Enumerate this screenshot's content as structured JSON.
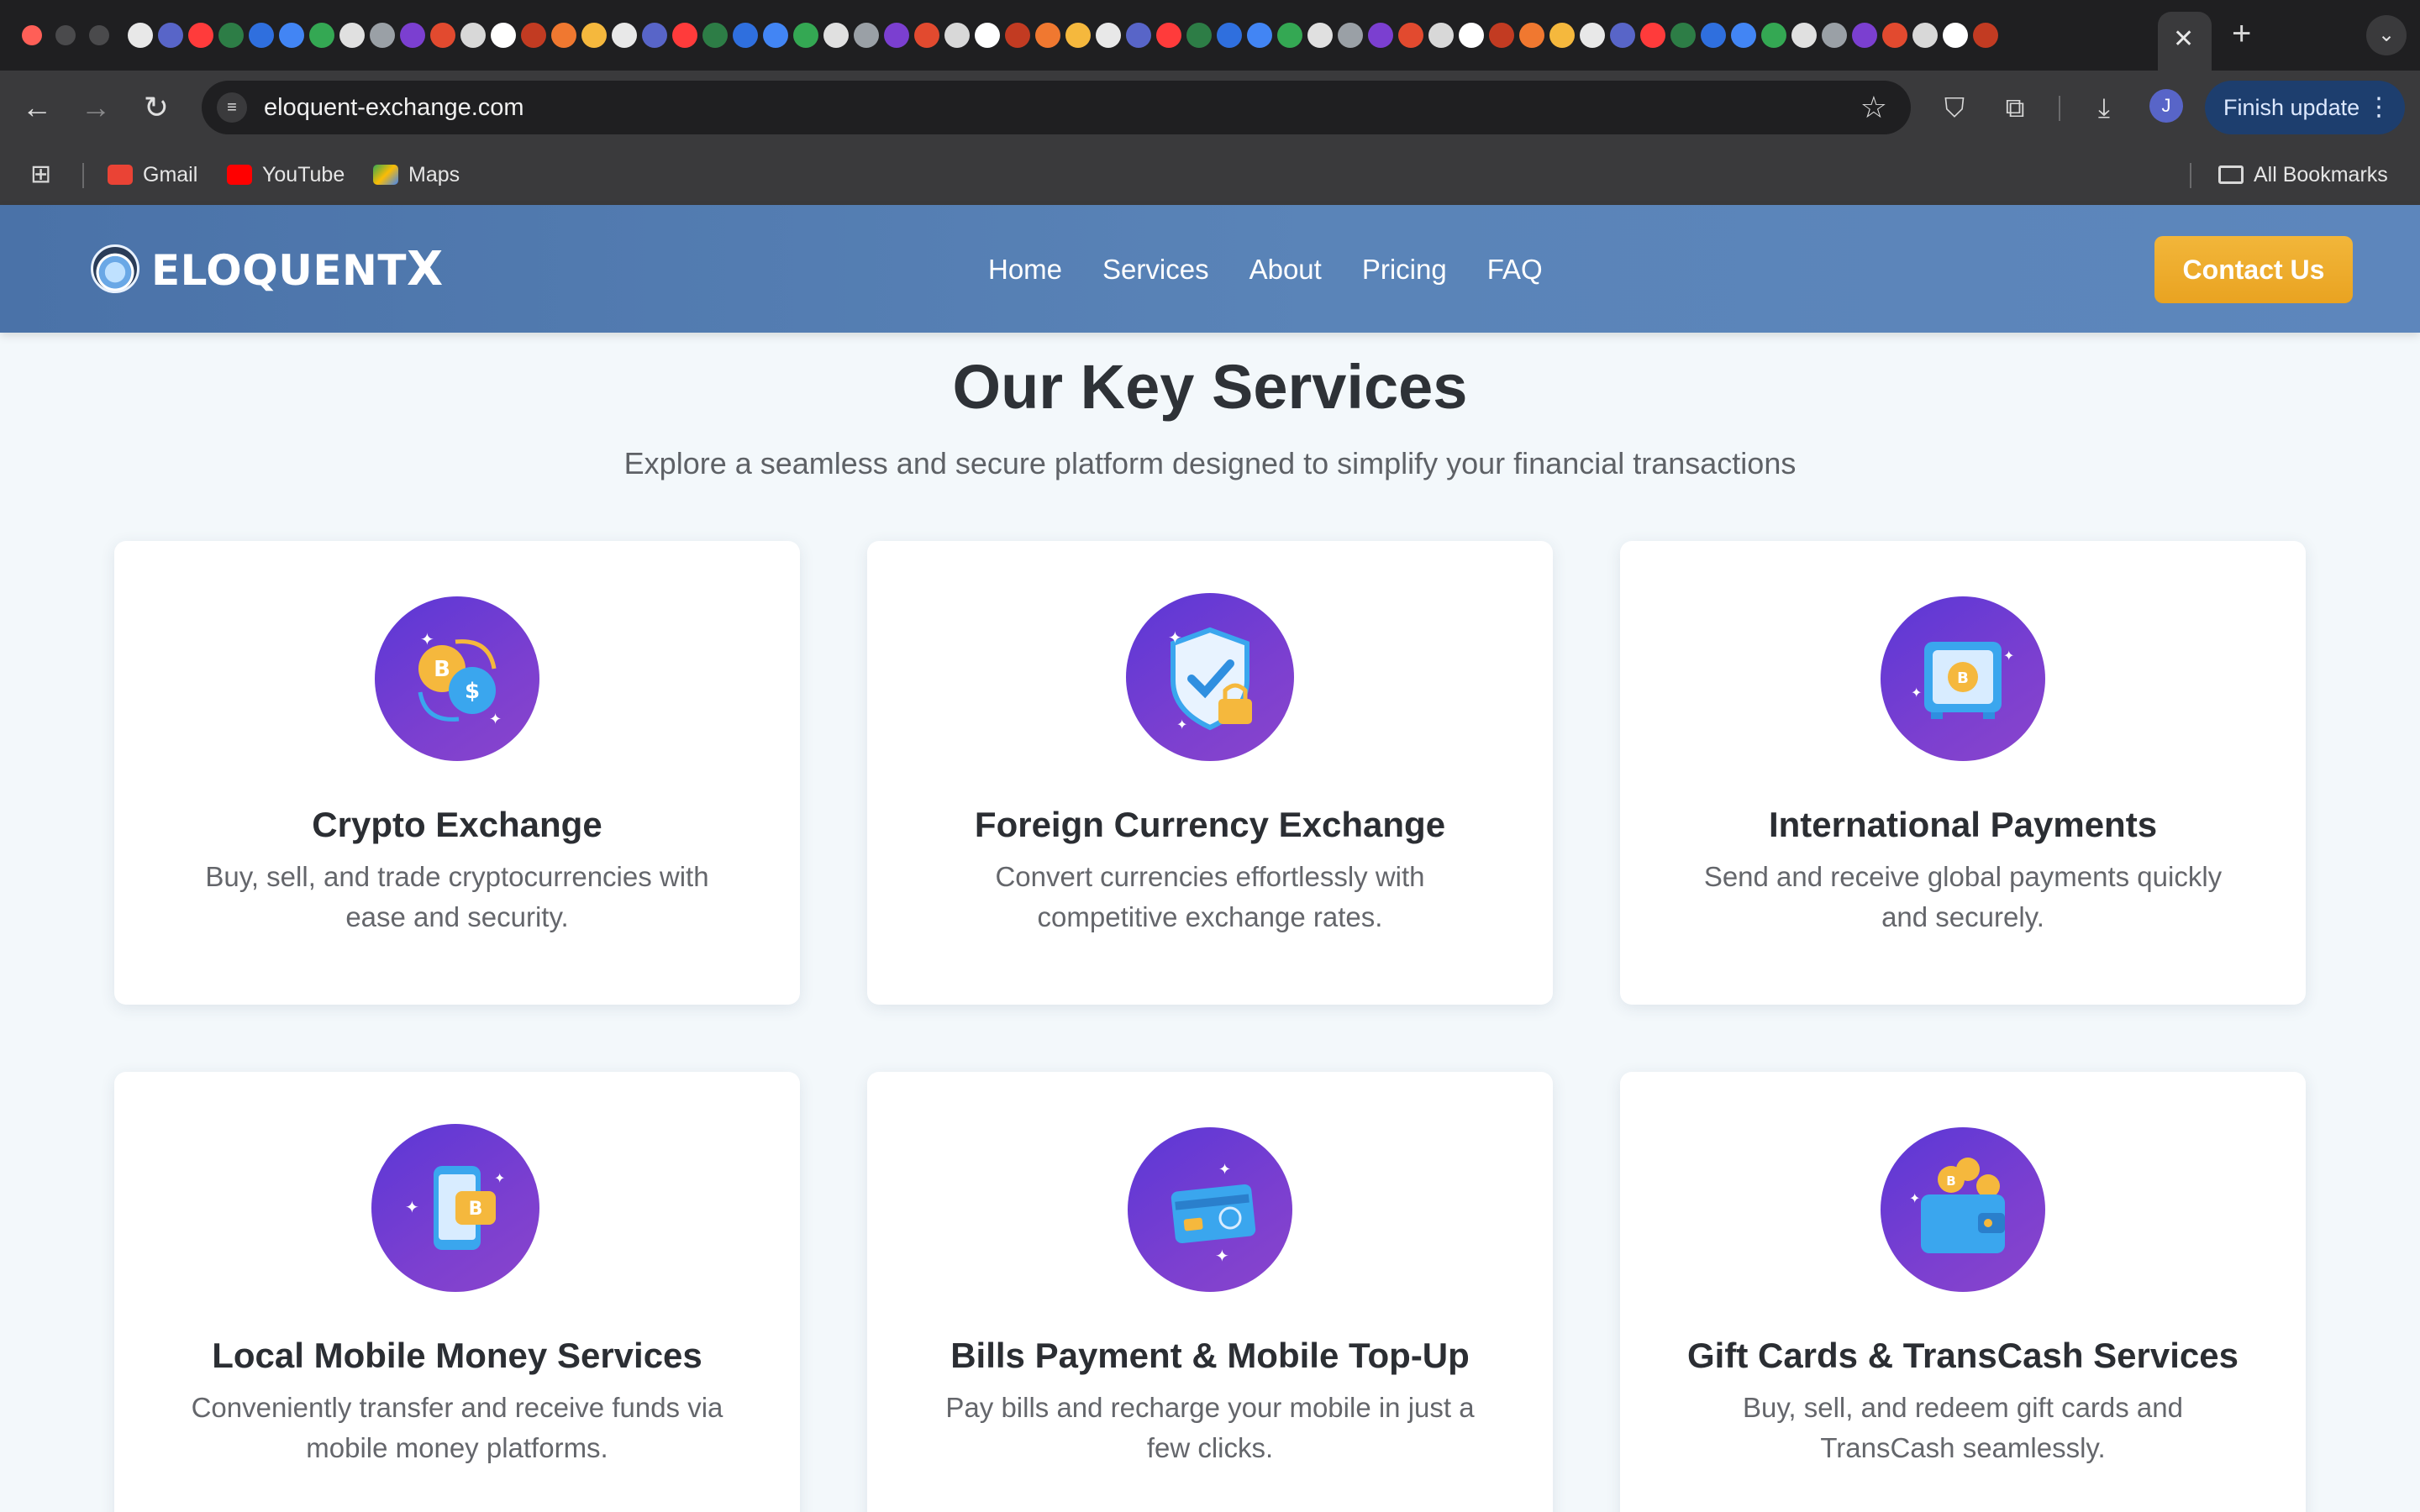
{
  "browser": {
    "tab_close": "✕",
    "new_tab": "+",
    "url": "eloquent-exchange.com",
    "profile_initial": "J",
    "finish_update_label": "Finish update",
    "bookmarks": [
      {
        "label": "Gmail",
        "color": "#ea4335"
      },
      {
        "label": "YouTube",
        "color": "#ff0000"
      },
      {
        "label": "Maps",
        "color": "#34a853"
      }
    ],
    "all_bookmarks_label": "All Bookmarks"
  },
  "site": {
    "logo_text": "ELOQUENT",
    "logo_x": "X",
    "nav": [
      "Home",
      "Services",
      "About",
      "Pricing",
      "FAQ"
    ],
    "contact_label": "Contact Us",
    "accent_color": "#e9a321",
    "header_color": "#5a84b8"
  },
  "services": {
    "title": "Our Key Services",
    "subtitle": "Explore a seamless and secure platform designed to simplify your financial transactions",
    "cards": [
      {
        "title": "Crypto Exchange",
        "desc": "Buy, sell, and trade cryptocurrencies with ease and security.",
        "icon": "crypto-exchange-icon"
      },
      {
        "title": "Foreign Currency Exchange",
        "desc": "Convert currencies effortlessly with competitive exchange rates.",
        "icon": "shield-lock-icon"
      },
      {
        "title": "International Payments",
        "desc": "Send and receive global payments quickly and securely.",
        "icon": "safe-vault-icon"
      },
      {
        "title": "Local Mobile Money Services",
        "desc": "Conveniently transfer and receive funds via mobile money platforms.",
        "icon": "mobile-money-icon"
      },
      {
        "title": "Bills Payment & Mobile Top-Up",
        "desc": "Pay bills and recharge your mobile in just a few clicks.",
        "icon": "credit-card-icon"
      },
      {
        "title": "Gift Cards & TransCash Services",
        "desc": "Buy, sell, and redeem gift cards and TransCash seamlessly.",
        "icon": "wallet-coins-icon"
      }
    ]
  }
}
